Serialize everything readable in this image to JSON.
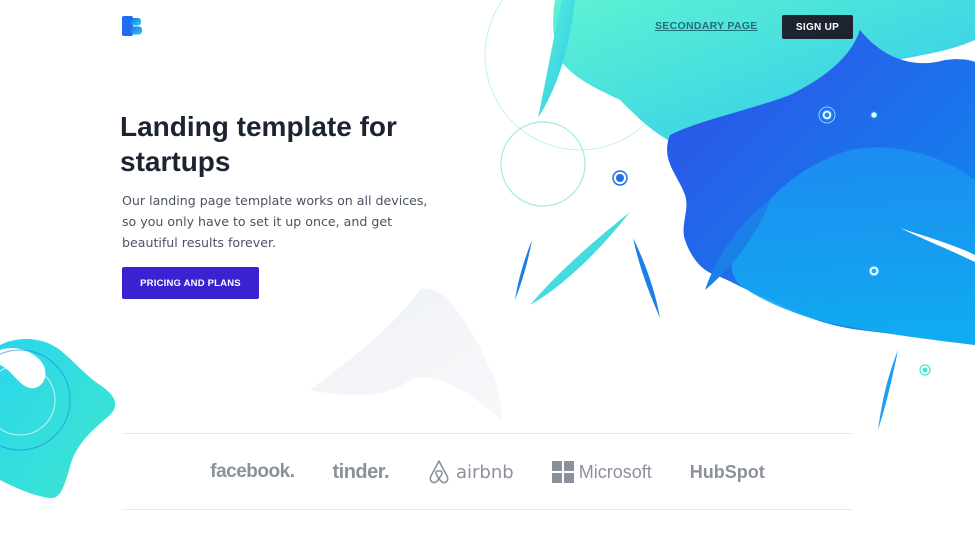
{
  "header": {
    "logo_icon": "brand-logo-icon",
    "nav_secondary_label": "SECONDARY PAGE",
    "signup_label": "SIGN UP"
  },
  "hero": {
    "title": "Landing template for startups",
    "description": "Our landing page template works on all devices, so you only have to set it up once, and get beautiful results forever.",
    "cta_label": "PRICING AND PLANS"
  },
  "clients": {
    "logos": [
      "facebook.",
      "tinder.",
      "airbnb",
      "Microsoft",
      "HubSpot"
    ]
  },
  "colors": {
    "primary": "#3b22d0",
    "dark": "#1e2330",
    "accent_cyan": "#3ee6d6",
    "accent_blue": "#1063e8",
    "logo_gray": "#8b919c"
  }
}
